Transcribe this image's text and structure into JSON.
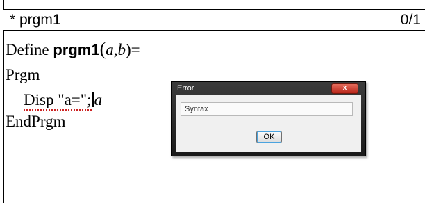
{
  "header": {
    "title": "* prgm1",
    "counter": "0/1"
  },
  "editor": {
    "line1": {
      "keyword": "Define",
      "program_name": "prgm1",
      "open_paren": "(",
      "params": "a,b",
      "close_paren_eq": ")="
    },
    "line2": "Prgm",
    "line3": {
      "text": "Disp \"a=\";",
      "trailing": "a"
    },
    "line4": "EndPrgm"
  },
  "dialog": {
    "title": "Error",
    "close_label": "x",
    "message": "Syntax",
    "ok_label": "OK"
  },
  "colors": {
    "dialog_titlebar": "#2a2a2a",
    "close_button": "#c9382a",
    "error_underline": "#cc2222"
  }
}
